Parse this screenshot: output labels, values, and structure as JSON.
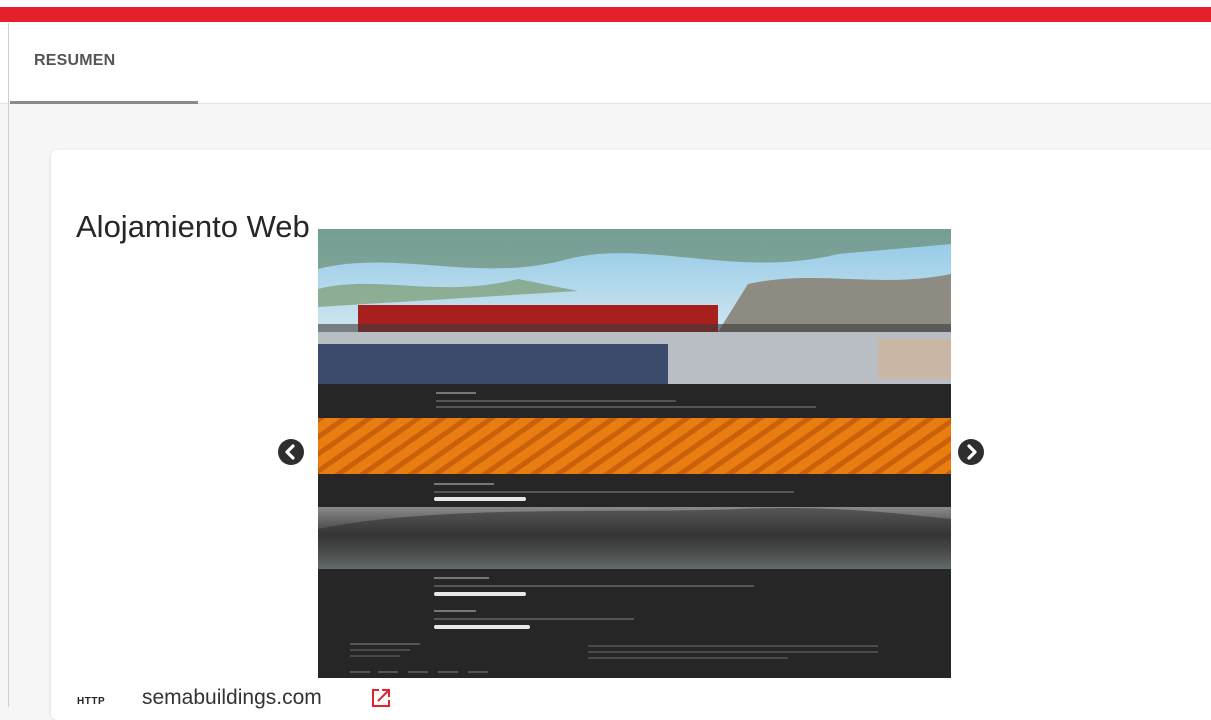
{
  "tabs": [
    {
      "label": "RESUMEN",
      "active": true
    }
  ],
  "card": {
    "title": "Alojamiento Web"
  },
  "carousel": {
    "prev_icon": "chevron-left-circle-icon",
    "next_icon": "chevron-right-circle-icon",
    "screenshot_alt": "website screenshot preview"
  },
  "site": {
    "protocol": "HTTP",
    "domain": "semabuildings.com",
    "link_icon": "external-link-icon"
  },
  "colors": {
    "brand_red": "#e5202b",
    "orange_banner": "#e97d12",
    "preview_dark": "#262626"
  }
}
